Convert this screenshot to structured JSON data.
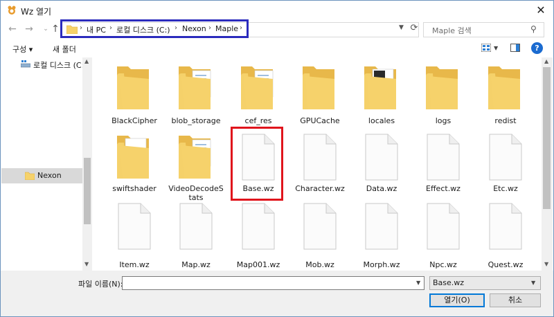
{
  "window": {
    "title": "Wz 열기",
    "close": "✕"
  },
  "nav": {
    "back": "←",
    "forward": "→",
    "recent": "⌄",
    "up": "↑",
    "breadcrumbs": [
      "내 PC",
      "로컬 디스크 (C:)",
      "Nexon",
      "Maple"
    ],
    "search_placeholder": "Maple 검색"
  },
  "toolbar": {
    "organize": "구성 ▾",
    "new_folder": "새 폴더",
    "help": "?"
  },
  "sidebar": {
    "items": [
      {
        "label": "로컬 디스크 (C:)"
      },
      {
        "label": "Nexon",
        "selected": true
      }
    ]
  },
  "files": [
    {
      "name": "BlackCipher",
      "type": "folder"
    },
    {
      "name": "blob_storage",
      "type": "folder-doc"
    },
    {
      "name": "cef_res",
      "type": "folder-doc"
    },
    {
      "name": "GPUCache",
      "type": "folder"
    },
    {
      "name": "locales",
      "type": "folder-app"
    },
    {
      "name": "logs",
      "type": "folder"
    },
    {
      "name": "redist",
      "type": "folder"
    },
    {
      "name": "swiftshader",
      "type": "folder-gear"
    },
    {
      "name": "VideoDecodeStats",
      "type": "folder-doc"
    },
    {
      "name": "Base.wz",
      "type": "file",
      "highlighted": true
    },
    {
      "name": "Character.wz",
      "type": "file"
    },
    {
      "name": "Data.wz",
      "type": "file"
    },
    {
      "name": "Effect.wz",
      "type": "file"
    },
    {
      "name": "Etc.wz",
      "type": "file"
    },
    {
      "name": "Item.wz",
      "type": "file"
    },
    {
      "name": "Map.wz",
      "type": "file"
    },
    {
      "name": "Map001.wz",
      "type": "file"
    },
    {
      "name": "Mob.wz",
      "type": "file"
    },
    {
      "name": "Morph.wz",
      "type": "file"
    },
    {
      "name": "Npc.wz",
      "type": "file"
    },
    {
      "name": "Quest.wz",
      "type": "file"
    }
  ],
  "bottom": {
    "filename_label": "파일 이름(N):",
    "filename_value": "",
    "filter_value": "Base.wz",
    "open_label": "열기(O)",
    "cancel_label": "취소"
  },
  "colors": {
    "folder": "#f6d26b",
    "folder_dark": "#e8b84a",
    "selection": "#d9d9d9",
    "address_highlight": "#2b2bbd",
    "file_highlight": "#e0141c",
    "accent": "#0078d7"
  }
}
